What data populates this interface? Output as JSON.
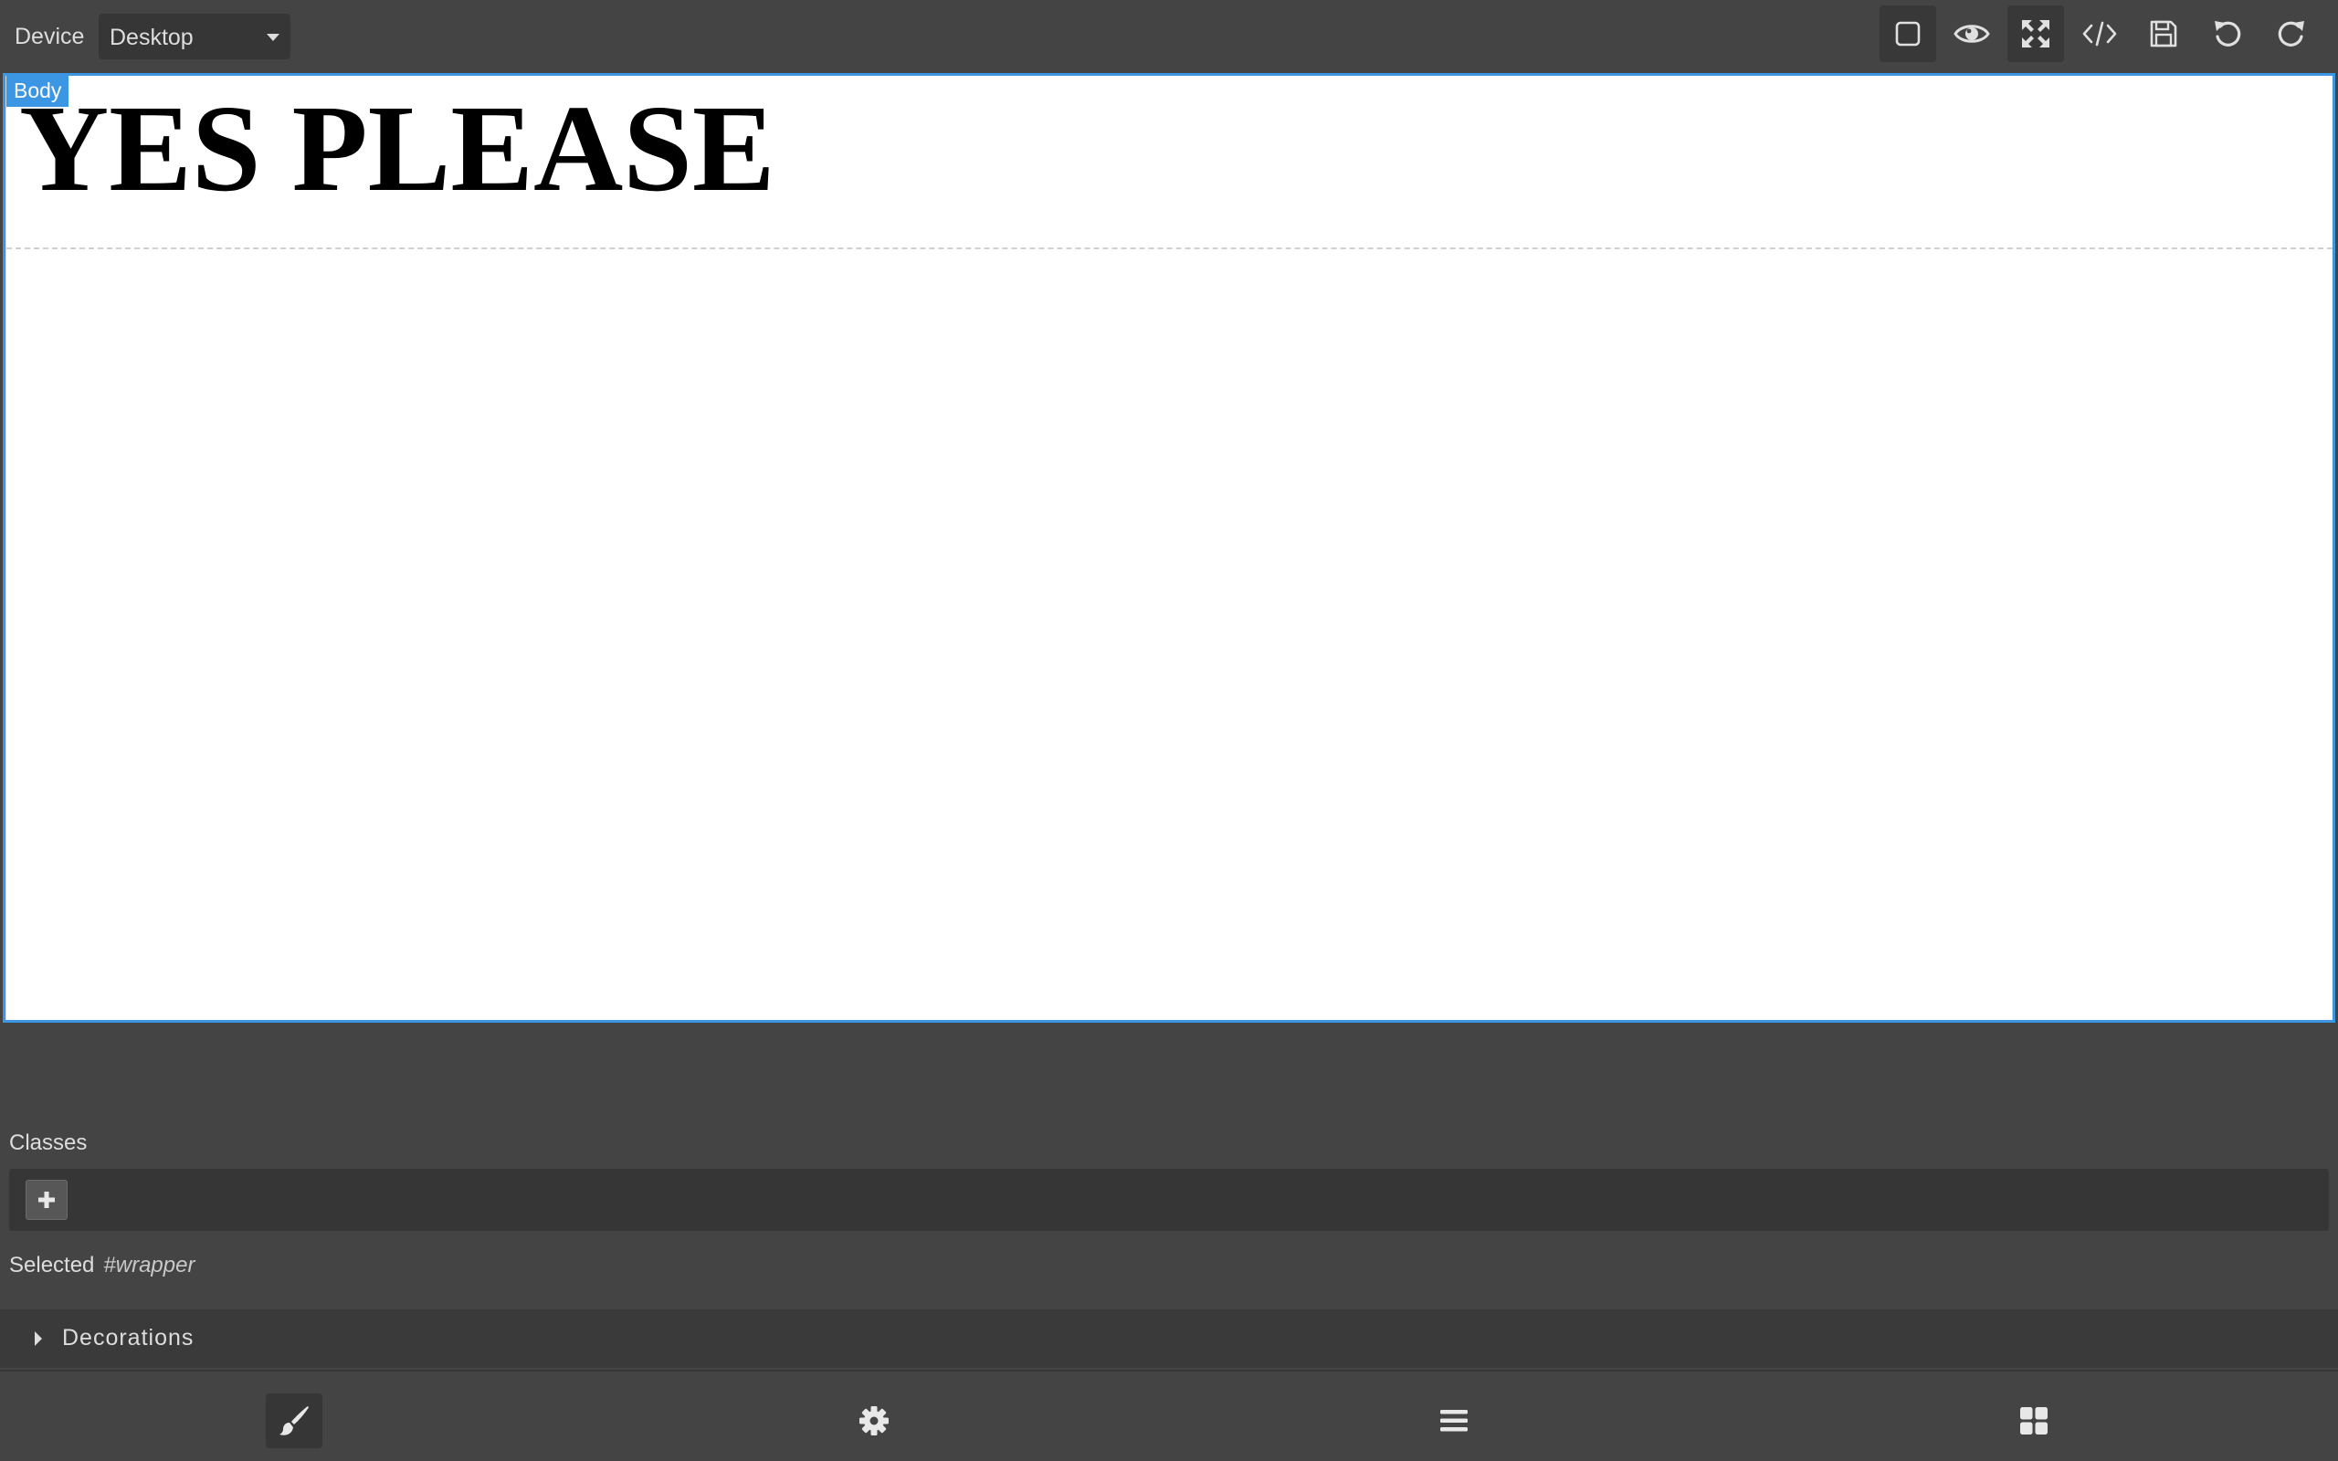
{
  "topbar": {
    "device_label": "Device",
    "device_value": "Desktop",
    "buttons": [
      "sw-visibility",
      "preview",
      "fullscreen",
      "export-code",
      "save",
      "undo",
      "redo"
    ]
  },
  "canvas": {
    "badge": "Body",
    "headline": "YES PLEASE"
  },
  "style_manager": {
    "classes_label": "Classes",
    "selected_label": "Selected",
    "selected_id": "#wrapper",
    "sector_title": "Decorations"
  },
  "bottom_tabs": [
    "style-manager",
    "trait-settings",
    "layer-manager",
    "block-manager"
  ],
  "colors": {
    "panel": "#444444",
    "accent": "#3b97e3",
    "canvas": "#ffffff"
  }
}
